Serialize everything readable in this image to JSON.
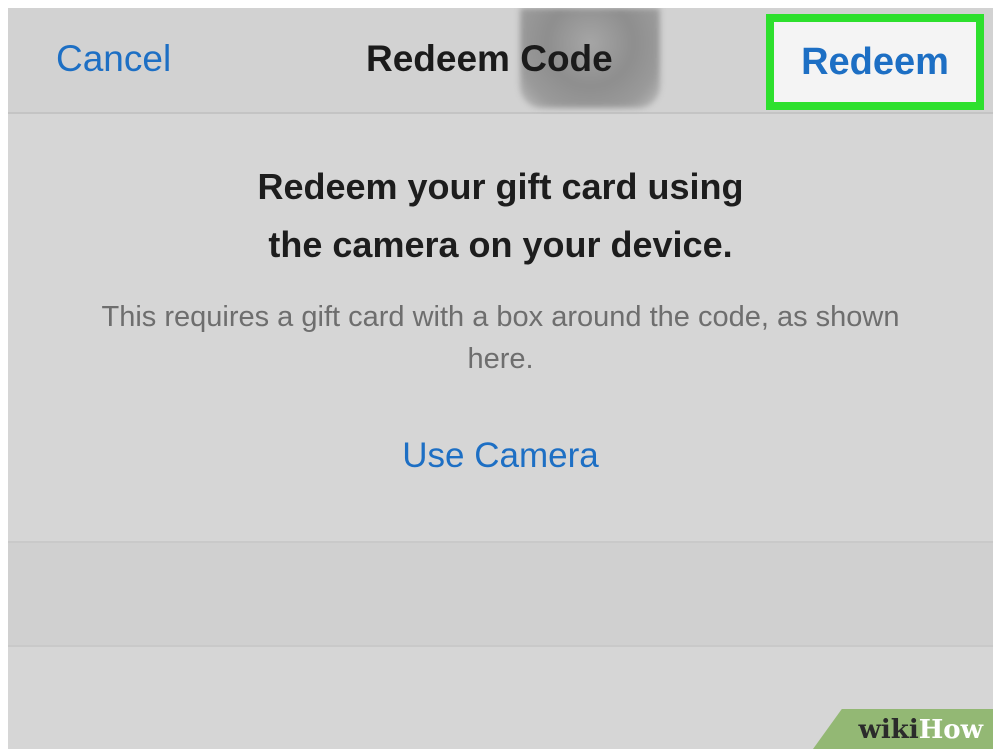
{
  "navbar": {
    "cancel_label": "Cancel",
    "title": "Redeem Code",
    "redeem_label": "Redeem"
  },
  "content": {
    "headline_line1": "Redeem your gift card using",
    "headline_line2": "the camera on your device.",
    "description": "This requires a gift card with a box around the code, as shown here.",
    "use_camera_label": "Use Camera"
  },
  "watermark": {
    "wiki": "wiki",
    "how": "How"
  },
  "colors": {
    "accent_blue": "#1d6fc4",
    "highlight_green": "#2de02d",
    "background": "#d6d6d6"
  }
}
